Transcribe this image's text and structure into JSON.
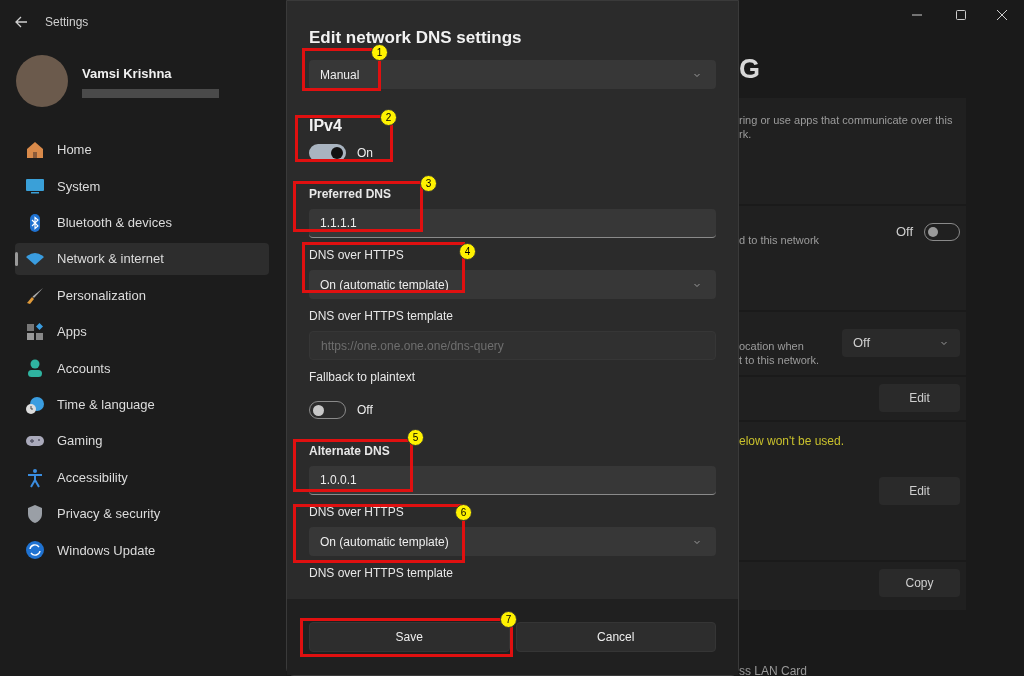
{
  "window": {
    "title": "Settings"
  },
  "profile": {
    "name": "Vamsi Krishna"
  },
  "sidebar": {
    "items": [
      {
        "label": "Home",
        "selected": false
      },
      {
        "label": "System",
        "selected": false
      },
      {
        "label": "Bluetooth & devices",
        "selected": false
      },
      {
        "label": "Network & internet",
        "selected": true
      },
      {
        "label": "Personalization",
        "selected": false
      },
      {
        "label": "Apps",
        "selected": false
      },
      {
        "label": "Accounts",
        "selected": false
      },
      {
        "label": "Time & language",
        "selected": false
      },
      {
        "label": "Gaming",
        "selected": false
      },
      {
        "label": "Accessibility",
        "selected": false
      },
      {
        "label": "Privacy & security",
        "selected": false
      },
      {
        "label": "Windows Update",
        "selected": false
      }
    ]
  },
  "background_page": {
    "heading": "G",
    "cards": [
      {
        "kind": "text",
        "lines": [
          "ring or use apps that communicate over this",
          "rk."
        ]
      },
      {
        "kind": "toggle",
        "lines": [
          "d to this network"
        ],
        "state_label": "Off",
        "on": false
      },
      {
        "kind": "dropdown",
        "lines": [
          "ocation when",
          "t to this network."
        ],
        "value": "Off"
      },
      {
        "kind": "button",
        "button": "Edit"
      },
      {
        "kind": "warning",
        "lines": [
          "elow won't be used."
        ],
        "button": "Edit"
      },
      {
        "kind": "button",
        "button": "Copy"
      }
    ],
    "footer_text": "ss LAN Card"
  },
  "dialog": {
    "title": "Edit network DNS settings",
    "fields": [
      {
        "kind": "dropdown",
        "value": "Manual"
      },
      {
        "kind": "section",
        "label": "IPv4"
      },
      {
        "kind": "toggle",
        "on": true,
        "state_label": "On"
      },
      {
        "kind": "input",
        "label": "Preferred DNS",
        "bold": true,
        "value": "1.1.1.1",
        "disabled": false
      },
      {
        "kind": "dropdown",
        "label": "DNS over HTTPS",
        "bold": false,
        "value": "On (automatic template)"
      },
      {
        "kind": "input",
        "label": "DNS over HTTPS template",
        "bold": false,
        "value": "https://one.one.one.one/dns-query",
        "disabled": true
      },
      {
        "kind": "toggle",
        "label": "Fallback to plaintext",
        "bold": false,
        "on": false,
        "state_label": "Off"
      },
      {
        "kind": "input",
        "label": "Alternate DNS",
        "bold": true,
        "value": "1.0.0.1",
        "disabled": false
      },
      {
        "kind": "dropdown",
        "label": "DNS over HTTPS",
        "bold": false,
        "value": "On (automatic template)"
      },
      {
        "kind": "label",
        "label": "DNS over HTTPS template",
        "bold": false
      }
    ],
    "buttons": [
      "Save",
      "Cancel"
    ]
  },
  "annotations": [
    {
      "number": "1"
    },
    {
      "number": "2"
    },
    {
      "number": "3"
    },
    {
      "number": "4"
    },
    {
      "number": "5"
    },
    {
      "number": "6"
    },
    {
      "number": "7"
    }
  ]
}
